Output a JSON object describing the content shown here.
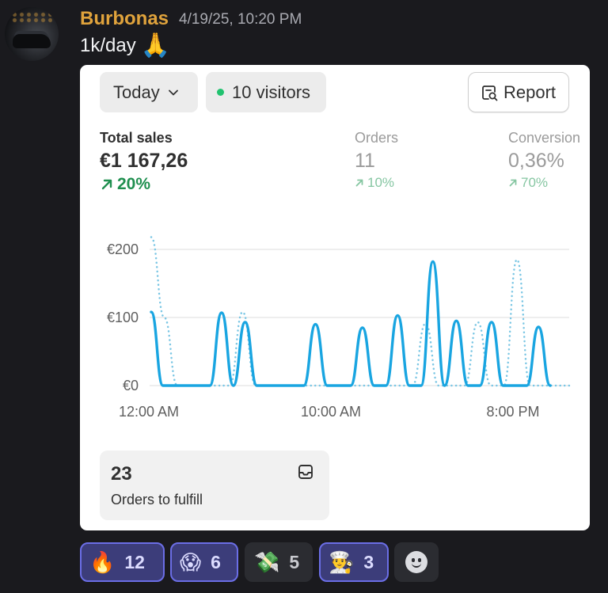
{
  "message": {
    "username": "Burbonas",
    "timestamp": "4/19/25, 10:20 PM",
    "text": "1k/day",
    "emoji": "🙏"
  },
  "card": {
    "date_filter": "Today",
    "visitors": "10 visitors",
    "report_label": "Report",
    "metrics": [
      {
        "label": "Total sales",
        "value": "€1 167,26",
        "change": "20%"
      },
      {
        "label": "Orders",
        "value": "11",
        "change": "10%"
      },
      {
        "label": "Conversion",
        "value": "0,36%",
        "change": "70%"
      }
    ],
    "fulfill": {
      "count": "23",
      "label": "Orders to fulfill"
    }
  },
  "chart_data": {
    "type": "line",
    "y_ticks": [
      "€200",
      "€100",
      "€0"
    ],
    "x_ticks": [
      "12:00 AM",
      "10:00 AM",
      "8:00 PM"
    ],
    "ylim": [
      0,
      200
    ],
    "x": [
      0,
      1,
      2,
      3,
      4,
      5,
      6,
      7,
      8,
      9,
      10,
      11,
      12,
      13,
      14,
      15,
      16,
      17,
      18,
      19,
      20,
      21,
      22,
      23
    ],
    "series": [
      {
        "style": "solid",
        "color": "#19a5e1",
        "values": [
          108,
          0,
          0,
          0,
          0,
          0,
          107,
          0,
          93,
          0,
          0,
          0,
          0,
          0,
          90,
          0,
          0,
          0,
          85,
          0,
          0,
          103,
          0,
          0,
          182,
          0,
          95,
          0,
          0,
          93,
          0,
          0,
          0,
          86,
          0
        ]
      },
      {
        "style": "dotted",
        "color": "#7ac6e4",
        "values": [
          218,
          100,
          0,
          0,
          0,
          0,
          0,
          108,
          0,
          0,
          0,
          0,
          0,
          0,
          0,
          0,
          0,
          0,
          0,
          0,
          0,
          91,
          0,
          0,
          0,
          93,
          0,
          0,
          185,
          0,
          0,
          0,
          0
        ]
      }
    ],
    "grid": true
  },
  "reactions": [
    {
      "emoji": "🔥",
      "count": "12",
      "active": true
    },
    {
      "emoji": "😱",
      "count": "6",
      "active": true
    },
    {
      "emoji": "💸",
      "count": "5",
      "active": false
    },
    {
      "emoji": "👨‍🍳",
      "count": "3",
      "active": true
    }
  ]
}
